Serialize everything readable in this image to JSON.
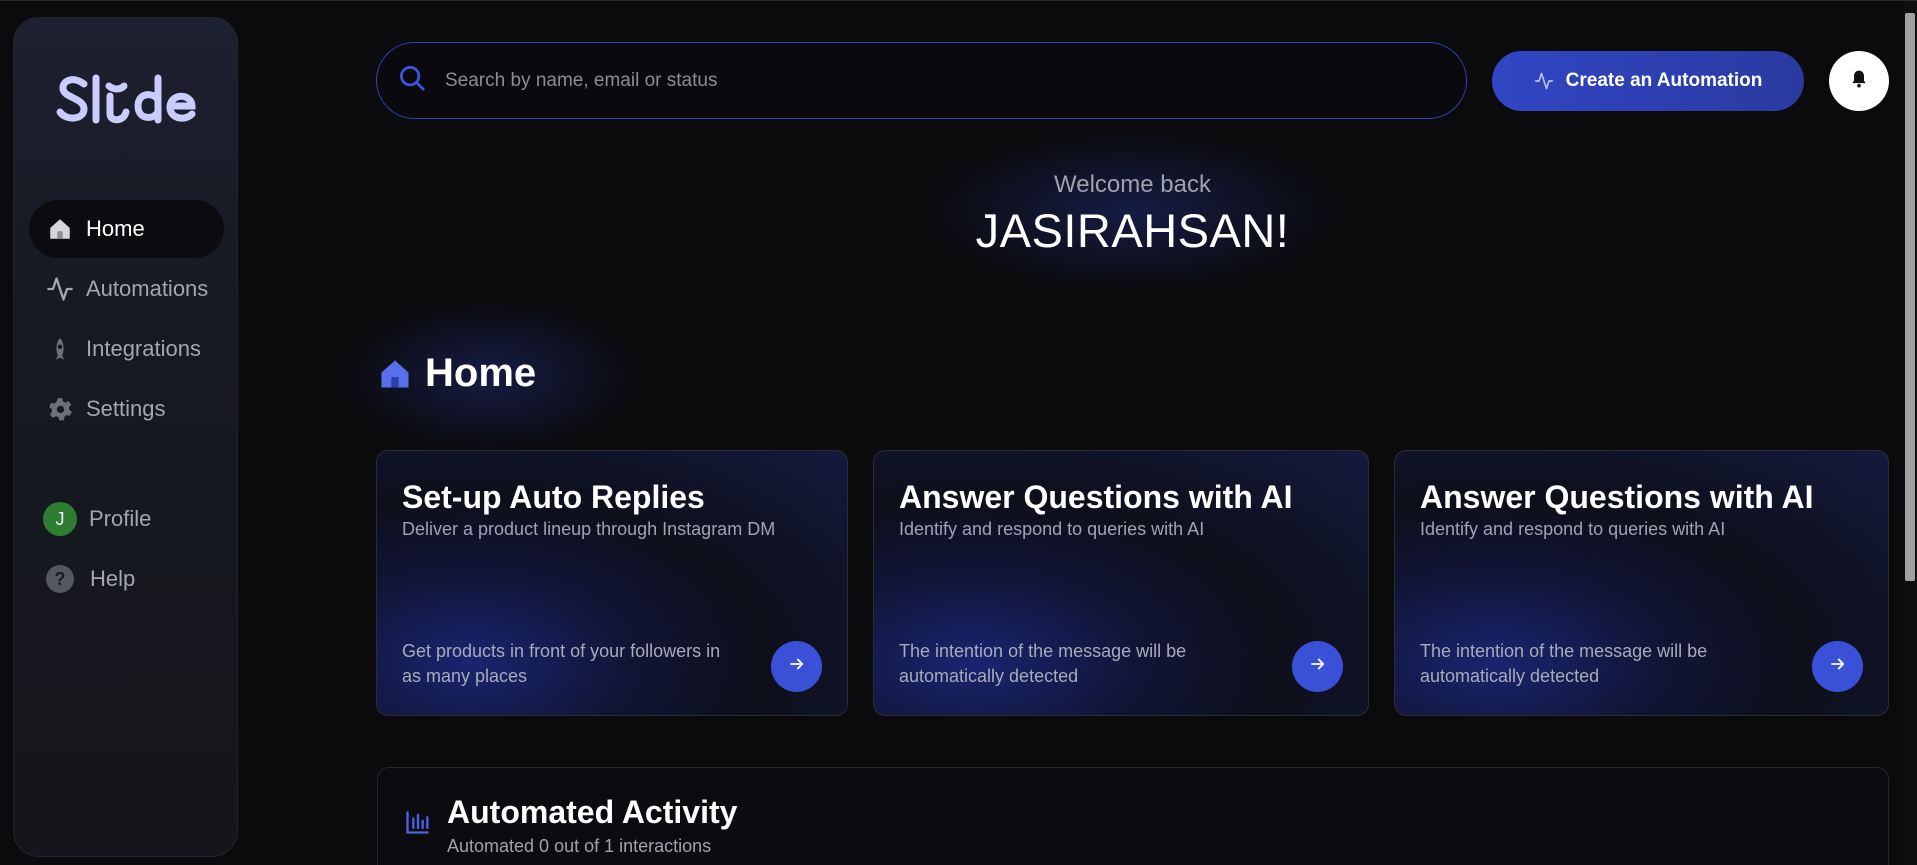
{
  "brand": {
    "logo_text": "Slide"
  },
  "sidebar": {
    "items": [
      {
        "label": "Home",
        "icon": "home-icon",
        "active": true
      },
      {
        "label": "Automations",
        "icon": "activity-icon",
        "active": false
      },
      {
        "label": "Integrations",
        "icon": "rocket-icon",
        "active": false
      },
      {
        "label": "Settings",
        "icon": "gear-icon",
        "active": false
      }
    ],
    "profile": {
      "label": "Profile",
      "avatar_initial": "J",
      "avatar_color": "#2e7d32"
    },
    "help": {
      "label": "Help",
      "icon_glyph": "?"
    }
  },
  "search": {
    "placeholder": "Search by name, email or status"
  },
  "header": {
    "cta_label": "Create an Automation",
    "accent": "#3146c4"
  },
  "welcome": {
    "subtitle": "Welcome back",
    "name": "JASIRAHSAN!"
  },
  "section": {
    "title": "Home"
  },
  "cards": [
    {
      "title": "Set-up Auto Replies",
      "subtitle": "Deliver a product lineup through Instagram DM",
      "footer": "Get products in front of your followers in as many places"
    },
    {
      "title": "Answer Questions with AI",
      "subtitle": "Identify and respond to queries with AI",
      "footer": "The intention of the message will be automatically detected"
    },
    {
      "title": "Answer Questions with AI",
      "subtitle": "Identify and respond to queries with AI",
      "footer": "The intention of the message will be automatically detected"
    }
  ],
  "activity": {
    "title": "Automated Activity",
    "subtitle": "Automated 0 out of 1 interactions"
  }
}
